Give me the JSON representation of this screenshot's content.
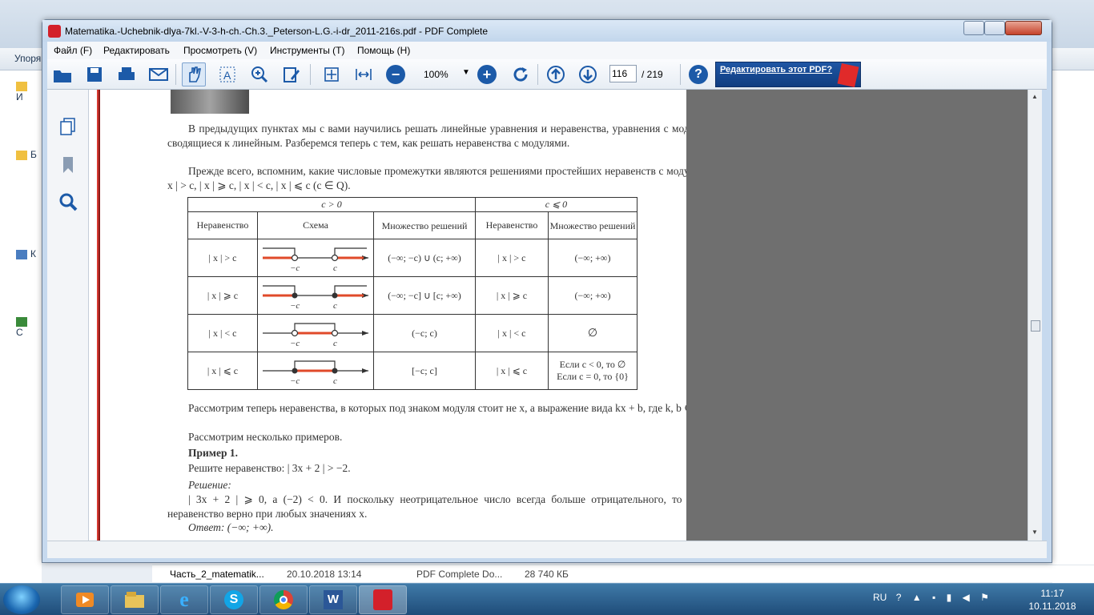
{
  "window": {
    "title": "Matematika.-Uchebnik-dlya-7kl.-V-3-h-ch.-Ch.3._Peterson-L.G.-i-dr_2011-216s.pdf - PDF Complete"
  },
  "menu": [
    "Файл (F)",
    "Редактировать",
    "Просмотреть (V)",
    "Инструменты (T)",
    "Помощь (H)"
  ],
  "toolbar": {
    "zoom": "100%",
    "page_current": "116",
    "page_total": "/ 219",
    "promo": "Редактировать этот PDF?"
  },
  "background": {
    "organize_label": "Упоря",
    "side_items": [
      "И",
      "Б",
      "К",
      "С"
    ],
    "file_row": {
      "name": "Часть_2_matematik...",
      "date": "20.10.2018 13:14",
      "type": "PDF Complete Do...",
      "size": "28 740 КБ"
    }
  },
  "document": {
    "para1": "В предыдущих пунктах мы с вами научились решать линейные уравнения и неравенства, уравнения с модулями, сводящиеся к линейным. Разберемся теперь с тем, как решать неравенства с модулями.",
    "para2": "Прежде всего, вспомним, какие числовые промежутки являются решениями простейших неравенств с модулями: | x | > c, | x | ⩾ c, | x | < c, | x | ⩽ c (c ∈ Q).",
    "table": {
      "group1": "c > 0",
      "group2": "c ⩽ 0",
      "headers": [
        "Неравенство",
        "Схема",
        "Множество решений",
        "Неравенство",
        "Множество решений"
      ],
      "rows": [
        {
          "ineq": "| x | > c",
          "set": "(−∞; −c) ∪ (c; +∞)",
          "ineq2": "| x | > c",
          "set2": "(−∞; +∞)"
        },
        {
          "ineq": "| x | ⩾ c",
          "set": "(−∞; −c] ∪ [c; +∞)",
          "ineq2": "| x | ⩾ c",
          "set2": "(−∞; +∞)"
        },
        {
          "ineq": "| x | < c",
          "set": "(−c; c)",
          "ineq2": "| x | < c",
          "set2": "∅"
        },
        {
          "ineq": "| x | ⩽ c",
          "set": "[−c; c]",
          "ineq2": "| x | ⩽ c",
          "set2a": "Если c < 0, то ∅",
          "set2b": "Если c = 0, то {0}"
        }
      ],
      "axis_neg": "−c",
      "axis_pos": "c"
    },
    "para3": "Рассмотрим теперь неравенства, в которых под знаком модуля стоит не x, а выражение вида kx + b, где k, b ∈ Q.",
    "para4": "Рассмотрим несколько примеров.",
    "example": "Пример 1.",
    "task": "Решите неравенство: | 3x + 2 | > −2.",
    "solution_label": "Решение:",
    "solution": "| 3x + 2 | ⩾ 0, а (−2) < 0. И поскольку неотрицательное число всегда больше отрицательного, то данное неравенство верно при любых значениях x.",
    "answer": "Ответ: (−∞; +∞)."
  },
  "taskbar": {
    "lang": "RU",
    "time": "11:17",
    "date": "10.11.2018"
  }
}
